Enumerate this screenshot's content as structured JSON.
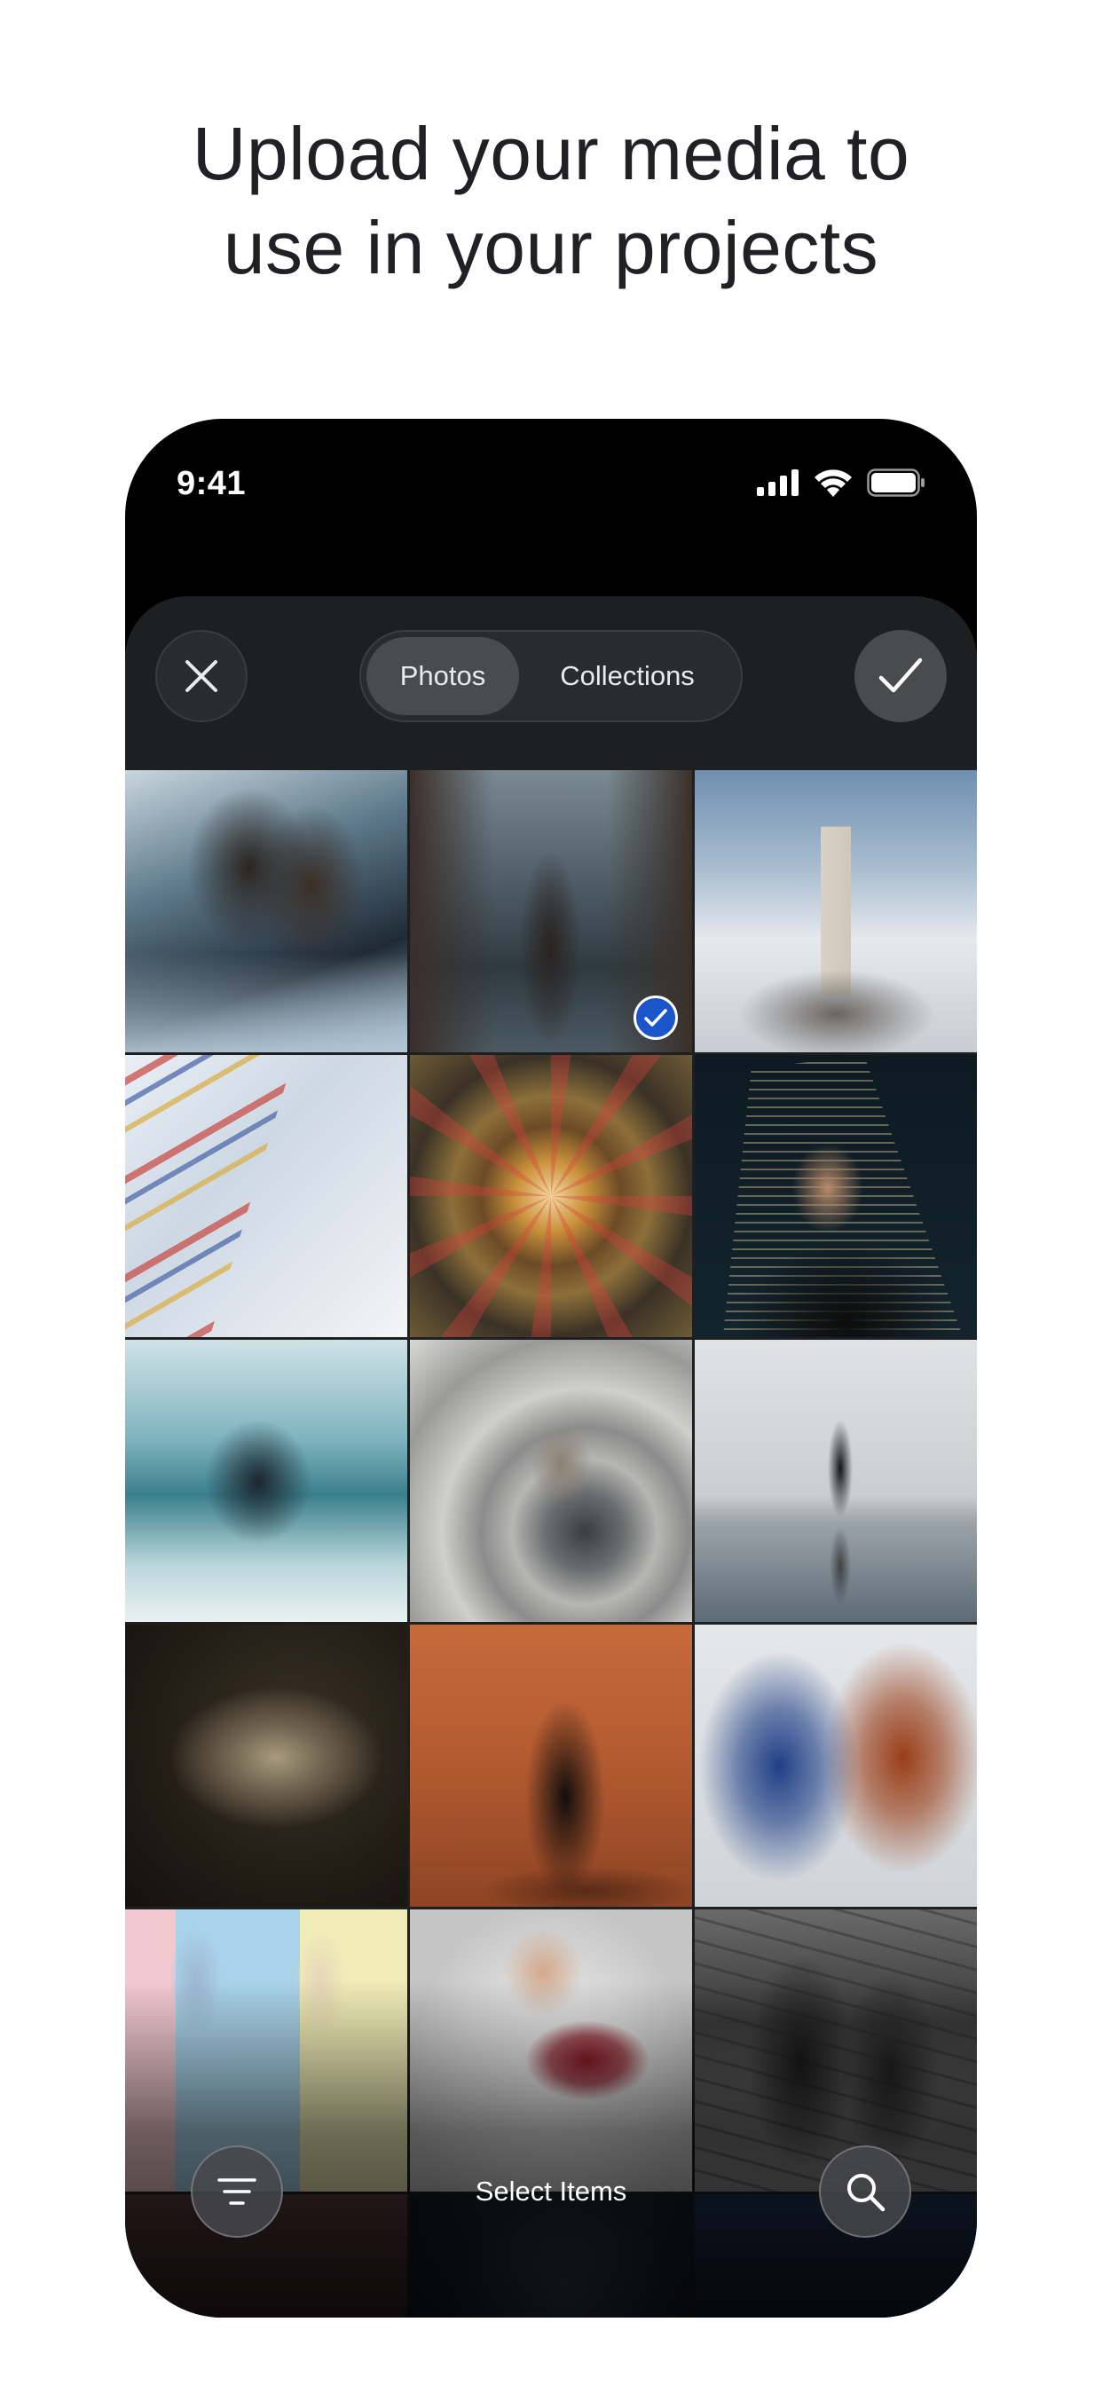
{
  "headline": {
    "line1": "Upload your media to",
    "line2": "use in your projects"
  },
  "status_bar": {
    "time": "9:41",
    "icons": [
      "cellular-signal-icon",
      "wifi-icon",
      "battery-icon"
    ]
  },
  "header": {
    "close_icon": "close-icon",
    "tabs": [
      {
        "label": "Photos",
        "active": true
      },
      {
        "label": "Collections",
        "active": false
      }
    ],
    "confirm_icon": "checkmark-icon"
  },
  "grid": {
    "selected_index": 1,
    "items": [
      {
        "name": "photo-couple-store"
      },
      {
        "name": "photo-woman-street-rain",
        "selected": true
      },
      {
        "name": "photo-lighthouse-clouds"
      },
      {
        "name": "photo-laundry-lines"
      },
      {
        "name": "photo-ornate-ceiling"
      },
      {
        "name": "photo-man-skyscraper"
      },
      {
        "name": "photo-dancer-mirror-room"
      },
      {
        "name": "photo-spiral-staircase"
      },
      {
        "name": "photo-woman-reflecting-pool"
      },
      {
        "name": "photo-lily-flower"
      },
      {
        "name": "photo-woman-desert"
      },
      {
        "name": "photo-fabric-blue-orange"
      },
      {
        "name": "photo-pastel-figures"
      },
      {
        "name": "photo-hand-reaching"
      },
      {
        "name": "photo-puddle-reflection"
      },
      {
        "name": "photo-dark-partial-1"
      },
      {
        "name": "photo-dark-partial-2"
      },
      {
        "name": "photo-dark-partial-3"
      }
    ]
  },
  "bottom_bar": {
    "filter_icon": "filter-icon",
    "label": "Select Items",
    "search_icon": "search-icon"
  },
  "colors": {
    "background": "#ffffff",
    "headline": "#202124",
    "sheet": "#1e1f21",
    "segment_active": "#4a4b4e",
    "selection_check": "#1a56c9"
  }
}
